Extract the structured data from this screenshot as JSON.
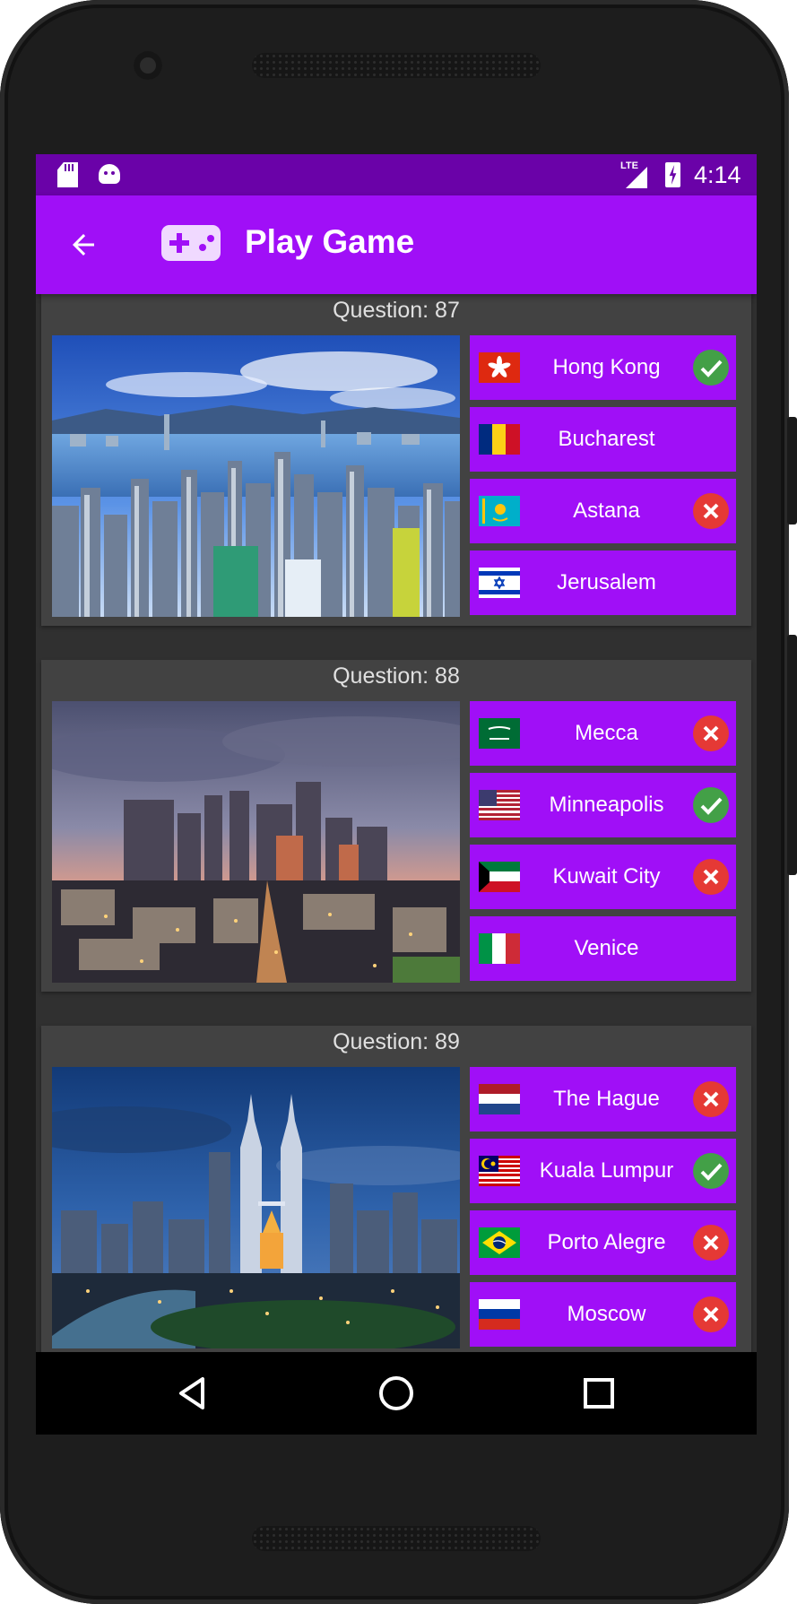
{
  "status_bar": {
    "time": "4:14",
    "network": "LTE"
  },
  "app_bar": {
    "title": "Play Game"
  },
  "questions": [
    {
      "label": "Question: 87",
      "photo": "hong-kong-skyline",
      "answers": [
        {
          "city": "Hong Kong",
          "flag": "hong-kong",
          "result": "correct"
        },
        {
          "city": "Bucharest",
          "flag": "romania",
          "result": "none"
        },
        {
          "city": "Astana",
          "flag": "kazakhstan",
          "result": "wrong"
        },
        {
          "city": "Jerusalem",
          "flag": "israel",
          "result": "none"
        }
      ]
    },
    {
      "label": "Question: 88",
      "photo": "minneapolis-skyline",
      "answers": [
        {
          "city": "Mecca",
          "flag": "saudi-arabia",
          "result": "wrong"
        },
        {
          "city": "Minneapolis",
          "flag": "united-states",
          "result": "correct"
        },
        {
          "city": "Kuwait City",
          "flag": "kuwait",
          "result": "wrong"
        },
        {
          "city": "Venice",
          "flag": "italy",
          "result": "none"
        }
      ]
    },
    {
      "label": "Question: 89",
      "photo": "kuala-lumpur-skyline",
      "answers": [
        {
          "city": "The Hague",
          "flag": "netherlands",
          "result": "wrong"
        },
        {
          "city": "Kuala Lumpur",
          "flag": "malaysia",
          "result": "correct"
        },
        {
          "city": "Porto Alegre",
          "flag": "brazil",
          "result": "wrong"
        },
        {
          "city": "Moscow",
          "flag": "russia",
          "result": "wrong"
        }
      ]
    }
  ],
  "colors": {
    "status_bar": "#6a02a8",
    "app_bar": "#a00ff7",
    "answer_button": "#a00ff7",
    "card": "#424242",
    "background": "#303030",
    "correct": "#43a047",
    "wrong": "#e53935"
  }
}
